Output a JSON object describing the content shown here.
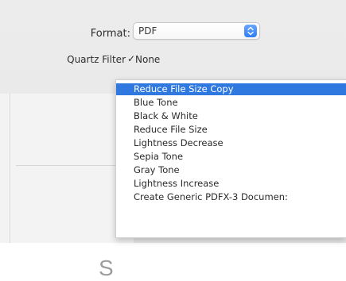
{
  "print_dialog": {
    "format": {
      "label": "Format:",
      "value": "PDF",
      "stepper_icon": "up-down-chevron-icon"
    },
    "quartz_filter": {
      "label": "Quartz Filter",
      "check": "✓",
      "current_value": "None"
    },
    "preview_letter": "S"
  },
  "filter_menu": {
    "items": [
      {
        "label": "Reduce File Size Copy",
        "highlighted": true
      },
      {
        "label": "Blue Tone"
      },
      {
        "label": "Black & White"
      },
      {
        "label": "Reduce File Size"
      },
      {
        "label": "Lightness Decrease"
      },
      {
        "label": "Sepia Tone"
      },
      {
        "label": "Gray Tone"
      },
      {
        "label": "Lightness Increase"
      },
      {
        "label": "Create Generic PDFX-3 Documen:"
      }
    ],
    "highlight_color": "#2f78df"
  }
}
